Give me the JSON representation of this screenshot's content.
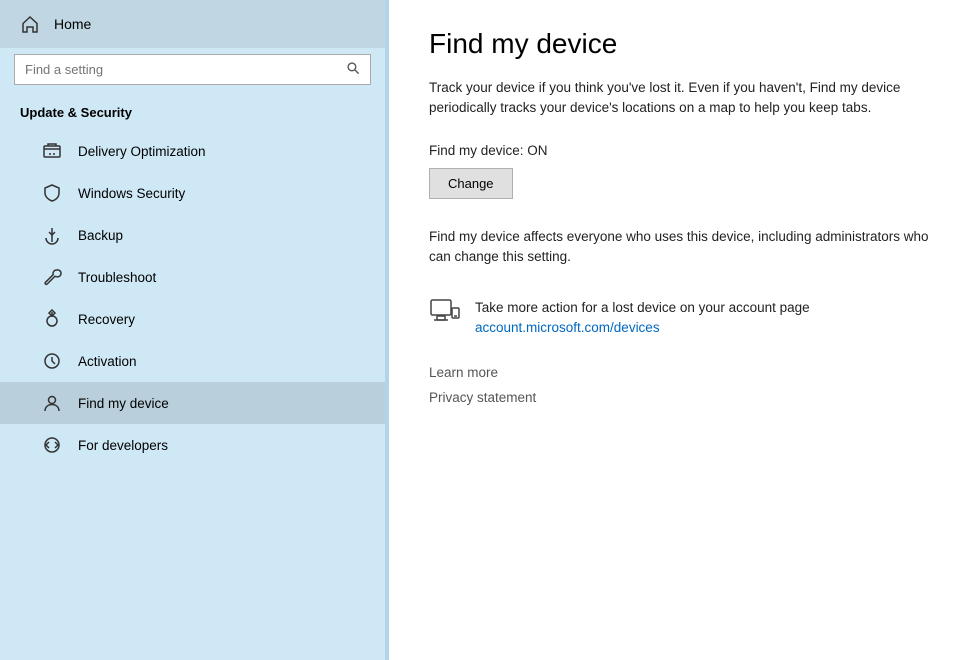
{
  "sidebar": {
    "home_label": "Home",
    "search_placeholder": "Find a setting",
    "section_label": "Update & Security",
    "items": [
      {
        "id": "delivery-optimization",
        "label": "Delivery Optimization",
        "icon": "delivery"
      },
      {
        "id": "windows-security",
        "label": "Windows Security",
        "icon": "shield"
      },
      {
        "id": "backup",
        "label": "Backup",
        "icon": "backup"
      },
      {
        "id": "troubleshoot",
        "label": "Troubleshoot",
        "icon": "wrench"
      },
      {
        "id": "recovery",
        "label": "Recovery",
        "icon": "recovery"
      },
      {
        "id": "activation",
        "label": "Activation",
        "icon": "activation"
      },
      {
        "id": "find-my-device",
        "label": "Find my device",
        "icon": "person",
        "active": true
      },
      {
        "id": "for-developers",
        "label": "For developers",
        "icon": "developer"
      }
    ]
  },
  "main": {
    "title": "Find my device",
    "description": "Track your device if you think you've lost it. Even if you haven't, Find my device periodically tracks your device's locations on a map to help you keep tabs.",
    "status_label": "Find my device: ON",
    "change_button": "Change",
    "affect_text": "Find my device affects everyone who uses this device, including administrators who can change this setting.",
    "action_label": "Take more action for a lost device on your account page",
    "action_link": "account.microsoft.com/devices",
    "footer_links": [
      {
        "id": "learn-more",
        "label": "Learn more"
      },
      {
        "id": "privacy-statement",
        "label": "Privacy statement"
      }
    ]
  }
}
